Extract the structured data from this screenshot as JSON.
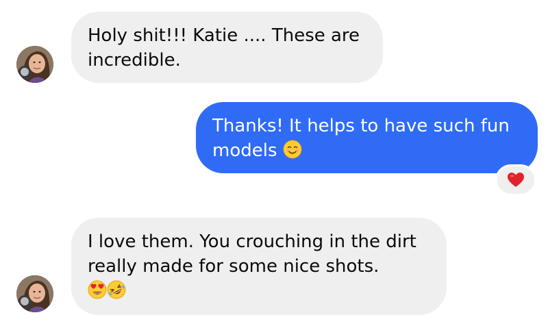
{
  "messages": [
    {
      "direction": "incoming",
      "text": "Holy shit!!!  Katie .... These are incredible."
    },
    {
      "direction": "outgoing",
      "text": "Thanks! It helps to have such fun models",
      "emoji": "smiling-face-with-smiling-eyes",
      "reaction": "red-heart"
    },
    {
      "direction": "incoming",
      "text": "I love them.   You crouching in the dirt really made for some nice shots.",
      "emojis": [
        "heart-eyes-face",
        "rolling-on-floor-laughing-face"
      ]
    }
  ],
  "colors": {
    "incoming_bubble": "#efefef",
    "outgoing_bubble": "#2f6bf5",
    "reaction_heart": "#e0242c"
  }
}
